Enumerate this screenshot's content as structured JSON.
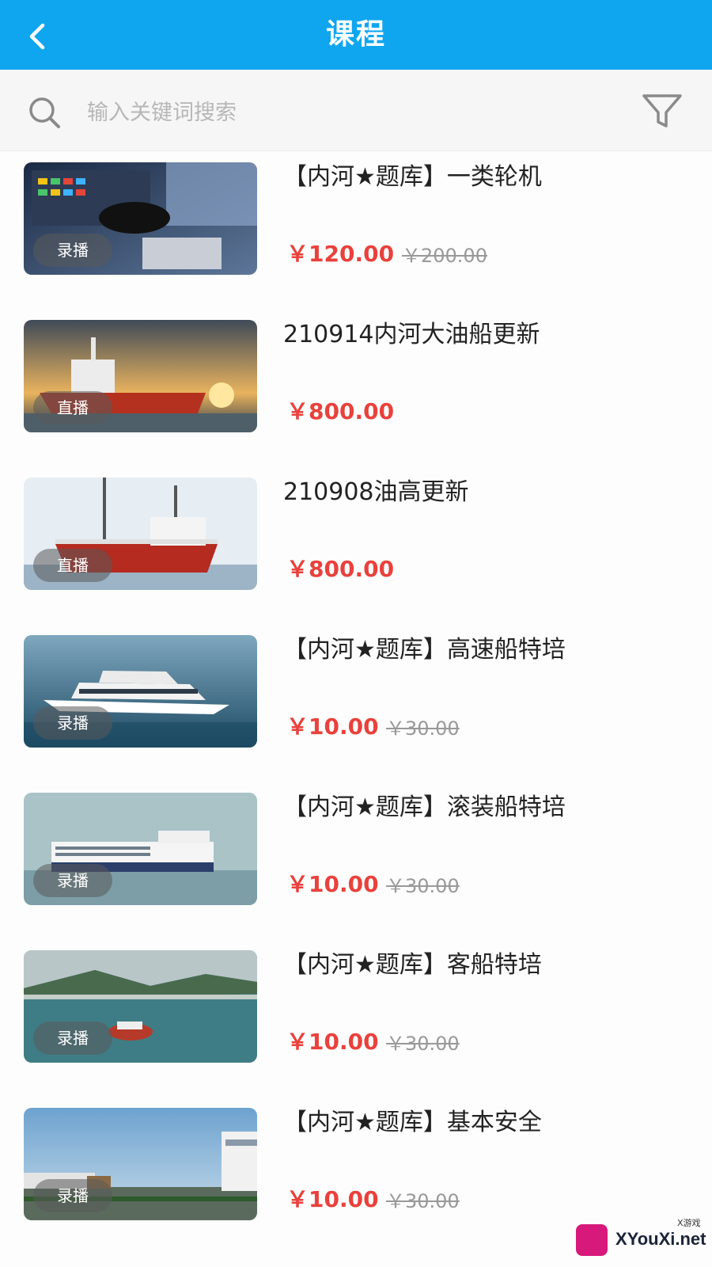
{
  "header": {
    "title": "课程",
    "back_icon": "chevron-left-icon"
  },
  "search": {
    "placeholder": "输入关键词搜索",
    "icon": "search-icon",
    "filter_icon": "filter-icon"
  },
  "colors": {
    "header_bg": "#0fa6ef",
    "price": "#e9413c",
    "original_price": "#999999"
  },
  "courses": [
    {
      "name": "【内河★题库】一类轮机",
      "tag": "录播",
      "price": "￥120.00",
      "original_price": "￥200.00"
    },
    {
      "name": "210914内河大油船更新",
      "tag": "直播",
      "price": "￥800.00",
      "original_price": ""
    },
    {
      "name": "210908油高更新",
      "tag": "直播",
      "price": "￥800.00",
      "original_price": ""
    },
    {
      "name": "【内河★题库】高速船特培",
      "tag": "录播",
      "price": "￥10.00",
      "original_price": "￥30.00"
    },
    {
      "name": "【内河★题库】滚装船特培",
      "tag": "录播",
      "price": "￥10.00",
      "original_price": "￥30.00"
    },
    {
      "name": "【内河★题库】客船特培",
      "tag": "录播",
      "price": "￥10.00",
      "original_price": "￥30.00"
    },
    {
      "name": "【内河★题库】基本安全",
      "tag": "录播",
      "price": "￥10.00",
      "original_price": "￥30.00"
    }
  ],
  "watermark": {
    "text": "XYouXi.net",
    "small": "X游戏"
  }
}
